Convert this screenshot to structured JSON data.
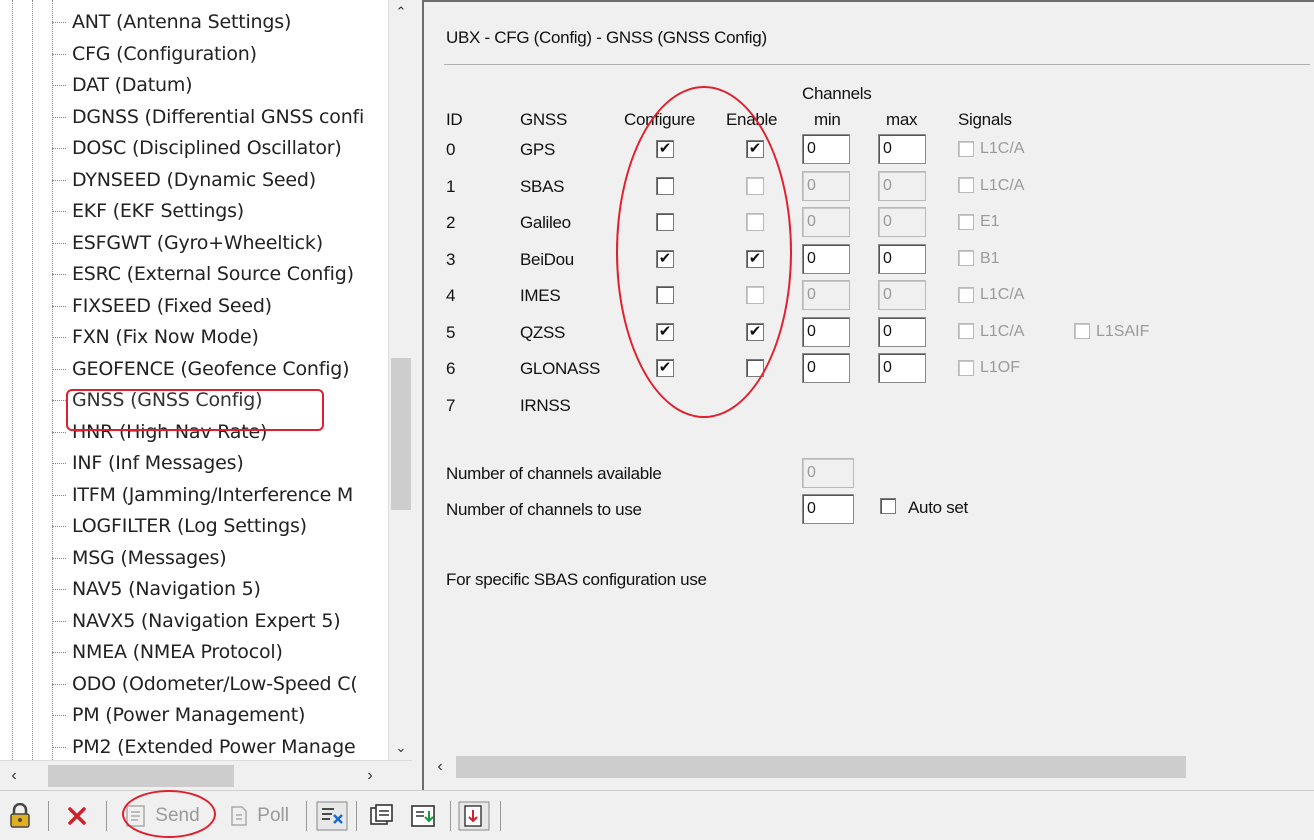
{
  "tree": {
    "items": [
      {
        "label": "ANT (Antenna Settings)"
      },
      {
        "label": "CFG (Configuration)"
      },
      {
        "label": "DAT (Datum)"
      },
      {
        "label": "DGNSS (Differential GNSS confi"
      },
      {
        "label": "DOSC (Disciplined Oscillator)"
      },
      {
        "label": "DYNSEED (Dynamic Seed)"
      },
      {
        "label": "EKF (EKF Settings)"
      },
      {
        "label": "ESFGWT (Gyro+Wheeltick)"
      },
      {
        "label": "ESRC (External Source Config)"
      },
      {
        "label": "FIXSEED (Fixed Seed)"
      },
      {
        "label": "FXN (Fix Now Mode)"
      },
      {
        "label": "GEOFENCE (Geofence Config)"
      },
      {
        "label": "GNSS (GNSS Config)",
        "selected": true
      },
      {
        "label": "HNR (High Nav Rate)"
      },
      {
        "label": "INF (Inf Messages)"
      },
      {
        "label": "ITFM (Jamming/Interference M"
      },
      {
        "label": "LOGFILTER (Log Settings)"
      },
      {
        "label": "MSG (Messages)"
      },
      {
        "label": "NAV5 (Navigation 5)"
      },
      {
        "label": "NAVX5 (Navigation Expert 5)"
      },
      {
        "label": "NMEA (NMEA Protocol)"
      },
      {
        "label": "ODO (Odometer/Low-Speed C("
      },
      {
        "label": "PM (Power Management)"
      },
      {
        "label": "PM2 (Extended Power Manage"
      }
    ]
  },
  "panel": {
    "title": "UBX - CFG (Config) - GNSS (GNSS Config)",
    "headers": {
      "channels": "Channels",
      "id": "ID",
      "gnss": "GNSS",
      "configure": "Configure",
      "enable": "Enable",
      "min": "min",
      "max": "max",
      "signals": "Signals"
    },
    "rows": [
      {
        "id": "0",
        "gnss": "GPS",
        "configure": true,
        "enable": true,
        "min": "0",
        "max": "0",
        "enabled": true,
        "signals": [
          "L1C/A"
        ]
      },
      {
        "id": "1",
        "gnss": "SBAS",
        "configure": false,
        "enable": false,
        "min": "0",
        "max": "0",
        "enabled": false,
        "signals": [
          "L1C/A"
        ]
      },
      {
        "id": "2",
        "gnss": "Galileo",
        "configure": false,
        "enable": false,
        "min": "0",
        "max": "0",
        "enabled": false,
        "signals": [
          "E1"
        ]
      },
      {
        "id": "3",
        "gnss": "BeiDou",
        "configure": true,
        "enable": true,
        "min": "0",
        "max": "0",
        "enabled": true,
        "signals": [
          "B1"
        ]
      },
      {
        "id": "4",
        "gnss": "IMES",
        "configure": false,
        "enable": false,
        "min": "0",
        "max": "0",
        "enabled": false,
        "signals": [
          "L1C/A"
        ]
      },
      {
        "id": "5",
        "gnss": "QZSS",
        "configure": true,
        "enable": true,
        "min": "0",
        "max": "0",
        "enabled": true,
        "signals": [
          "L1C/A",
          "L1SAIF"
        ]
      },
      {
        "id": "6",
        "gnss": "GLONASS",
        "configure": true,
        "enable": false,
        "min": "0",
        "max": "0",
        "enabled": true,
        "signals": [
          "L1OF"
        ]
      },
      {
        "id": "7",
        "gnss": "IRNSS"
      }
    ],
    "channels_available_label": "Number of channels available",
    "channels_available_value": "0",
    "channels_to_use_label": "Number of channels to use",
    "channels_to_use_value": "0",
    "auto_set_label": "Auto set",
    "auto_set_checked": false,
    "sbas_note": "For specific SBAS configuration use"
  },
  "toolbar": {
    "send_label": "Send",
    "poll_label": "Poll",
    "send_enabled": false,
    "poll_enabled": false
  },
  "colors": {
    "annotation": "#e0202c",
    "disabled_text": "#9a9a9a",
    "delete_icon": "#d0202c",
    "lock_icon": "#e0b020"
  },
  "icons": [
    "lock-icon",
    "delete-icon",
    "send-icon",
    "poll-icon",
    "auto-poll-icon",
    "load-icon",
    "store-icon",
    "save-icon"
  ]
}
